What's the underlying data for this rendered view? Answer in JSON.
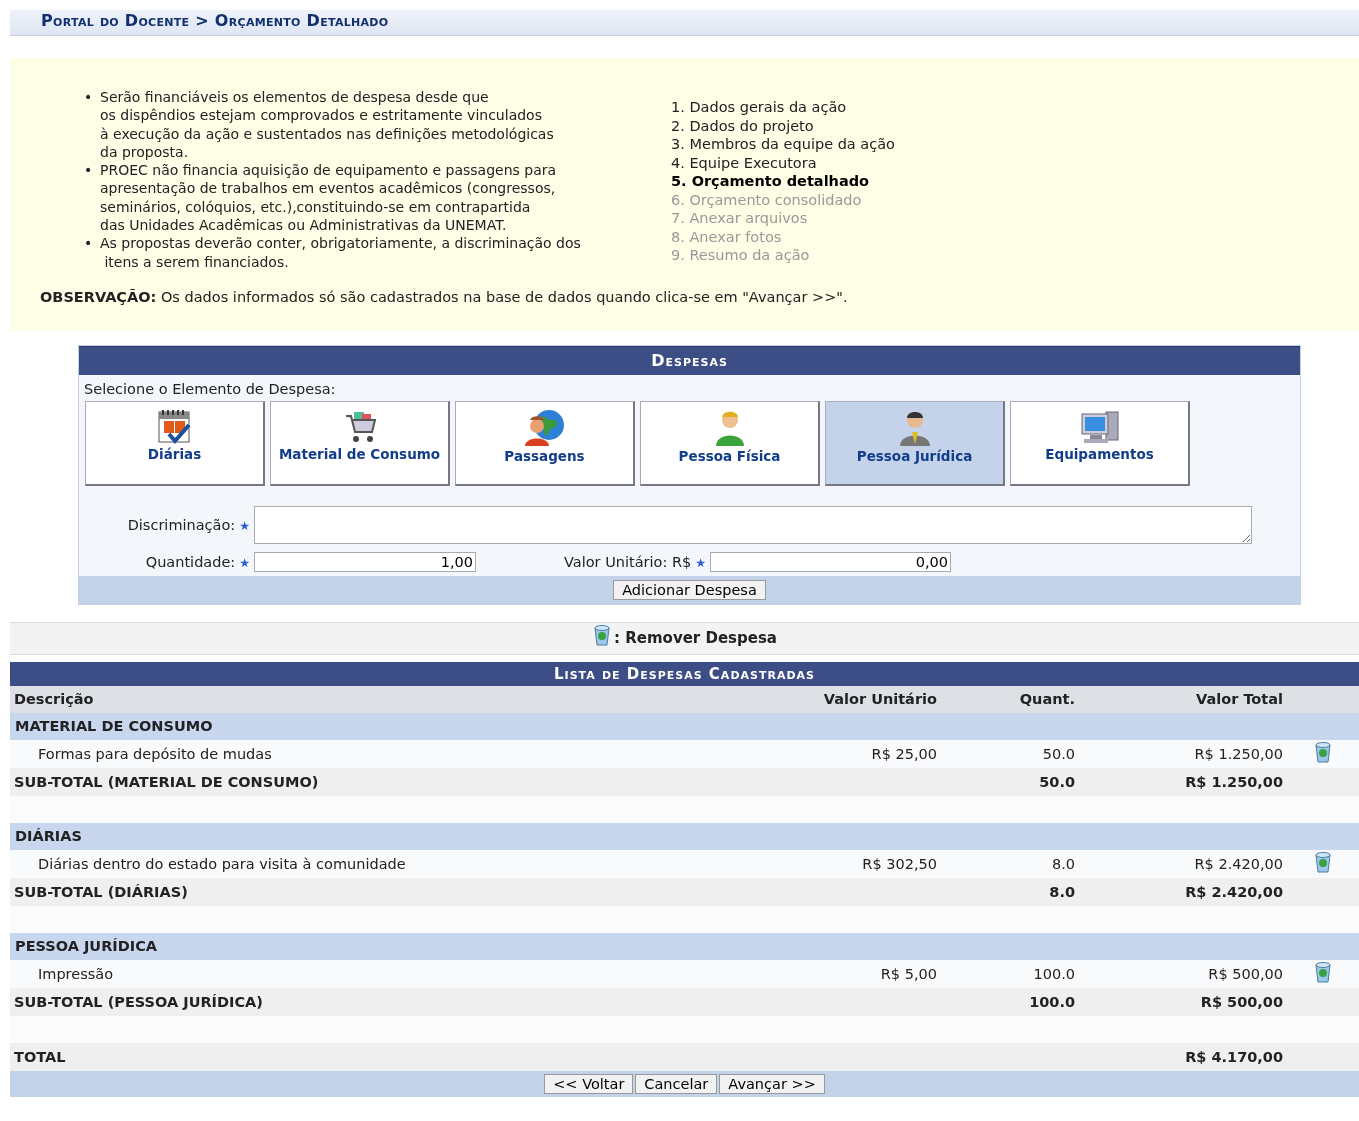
{
  "breadcrumb": "Portal do Docente > Orçamento Detalhado",
  "instructions": {
    "bullets": [
      "Serão financiáveis os elementos de despesa desde que\nos dispêndios estejam comprovados e estritamente vinculados\nà execução da ação e sustentados nas definições metodológicas\nda proposta.",
      "PROEC não financia aquisição de equipamento e passagens para\napresentação de trabalhos em eventos acadêmicos (congressos,\nseminários, colóquios, etc.),constituindo-se em contrapartida\ndas Unidades Acadêmicas ou Administrativas da UNEMAT.",
      "As propostas deverão conter, obrigatoriamente, a discriminação dos\n itens a serem financiados."
    ],
    "bullet": "•",
    "steps": [
      {
        "label": "1. Dados gerais da ação",
        "selected": false,
        "disabled": false
      },
      {
        "label": "2. Dados do projeto",
        "selected": false,
        "disabled": false
      },
      {
        "label": "3. Membros da equipe da ação",
        "selected": false,
        "disabled": false
      },
      {
        "label": "4. Equipe Executora",
        "selected": false,
        "disabled": false
      },
      {
        "label": "5. Orçamento detalhado",
        "selected": true,
        "disabled": false
      },
      {
        "label": "6. Orçamento consolidado",
        "selected": false,
        "disabled": true
      },
      {
        "label": "7. Anexar arquivos",
        "selected": false,
        "disabled": true
      },
      {
        "label": "8. Anexar fotos",
        "selected": false,
        "disabled": true
      },
      {
        "label": "9. Resumo da ação",
        "selected": false,
        "disabled": true
      }
    ],
    "note": "**OBSERVAÇÃO:** Os dados informados só são cadastrados na base de dados quando clica-se em \"Avançar >>\"."
  },
  "despesas": {
    "title": "Despesas",
    "prompt": "Selecione o Elemento de Despesa:",
    "elements": [
      {
        "label": "Diárias",
        "kind": "calendar",
        "selected": false
      },
      {
        "label": "Material de Consumo",
        "kind": "cart",
        "selected": false
      },
      {
        "label": "Passagens",
        "kind": "globe",
        "selected": false
      },
      {
        "label": "Pessoa Física",
        "kind": "person",
        "selected": false
      },
      {
        "label": "Pessoa Jurídica",
        "kind": "businessman",
        "selected": true
      },
      {
        "label": "Equipamentos",
        "kind": "computer",
        "selected": false
      }
    ],
    "discriminacao_label": "Discriminação:",
    "required_mark": "★",
    "quantidade_label": "Quantidade:",
    "quantidade_value": "1,00",
    "valor_label": "Valor Unitário: R$",
    "valor_value": "0,00",
    "add_button": "Adicionar Despesa"
  },
  "legend": ": Remover Despesa",
  "list": {
    "title": "Lista de Despesas Cadastradas",
    "columns": [
      "Descrição",
      "Valor Unitário",
      "Quant.",
      "Valor Total"
    ],
    "rows": [
      {
        "kind": "group",
        "cells": [
          "MATERIAL DE CONSUMO"
        ]
      },
      {
        "kind": "item",
        "cells": [
          "Formas para depósito de mudas",
          "R$ 25,00",
          "50.0",
          "R$ 1.250,00"
        ]
      },
      {
        "kind": "subtotal",
        "cells": [
          "SUB-TOTAL (MATERIAL DE CONSUMO)",
          "",
          "50.0",
          "R$ 1.250,00"
        ]
      },
      {
        "kind": "group",
        "cells": [
          "DIÁRIAS"
        ]
      },
      {
        "kind": "item",
        "cells": [
          "Diárias dentro do estado para visita à comunidade",
          "R$ 302,50",
          "8.0",
          "R$ 2.420,00"
        ]
      },
      {
        "kind": "subtotal",
        "cells": [
          "SUB-TOTAL (DIÁRIAS)",
          "",
          "8.0",
          "R$ 2.420,00"
        ]
      },
      {
        "kind": "group",
        "cells": [
          "PESSOA JURÍDICA"
        ]
      },
      {
        "kind": "item",
        "cells": [
          "Impressão",
          "R$ 5,00",
          "100.0",
          "R$ 500,00"
        ]
      },
      {
        "kind": "subtotal",
        "cells": [
          "SUB-TOTAL (PESSOA JURÍDICA)",
          "",
          "100.0",
          "R$ 500,00"
        ]
      },
      {
        "kind": "total",
        "cells": [
          "TOTAL",
          "",
          "",
          "R$ 4.170,00"
        ]
      }
    ],
    "buttons": [
      "<< Voltar",
      "Cancelar",
      "Avançar >>"
    ]
  }
}
